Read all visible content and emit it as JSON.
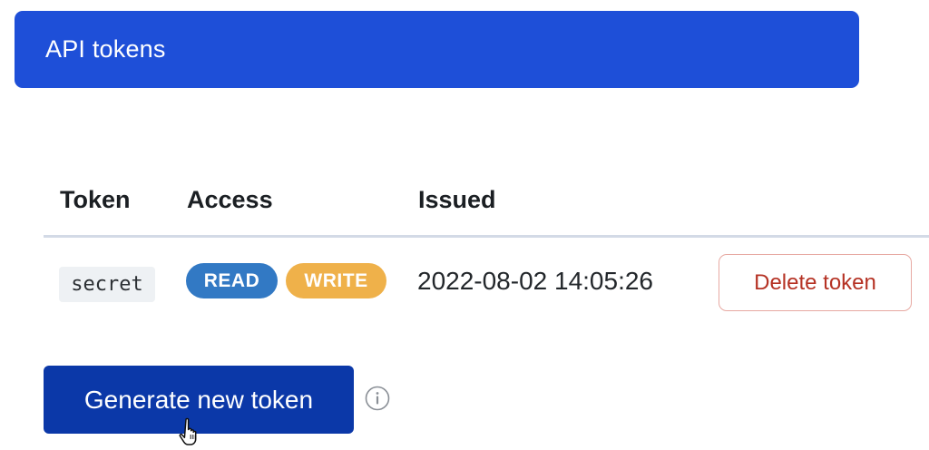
{
  "theme": {
    "accent": "#1e4fd8",
    "primary_button": "#0b38a8",
    "read_badge": "#3279c4",
    "write_badge": "#efb14a",
    "danger_text": "#b53224"
  },
  "header": {
    "title": "API tokens"
  },
  "table": {
    "columns": [
      "Token",
      "Access",
      "Issued"
    ],
    "rows": [
      {
        "token": "secret",
        "access": [
          "READ",
          "WRITE"
        ],
        "issued": "2022-08-02 14:05:26",
        "action_label": "Delete token"
      }
    ]
  },
  "actions": {
    "generate_label": "Generate new token"
  },
  "icons": {
    "info": "info-icon",
    "cursor": "hand-pointer-icon"
  }
}
